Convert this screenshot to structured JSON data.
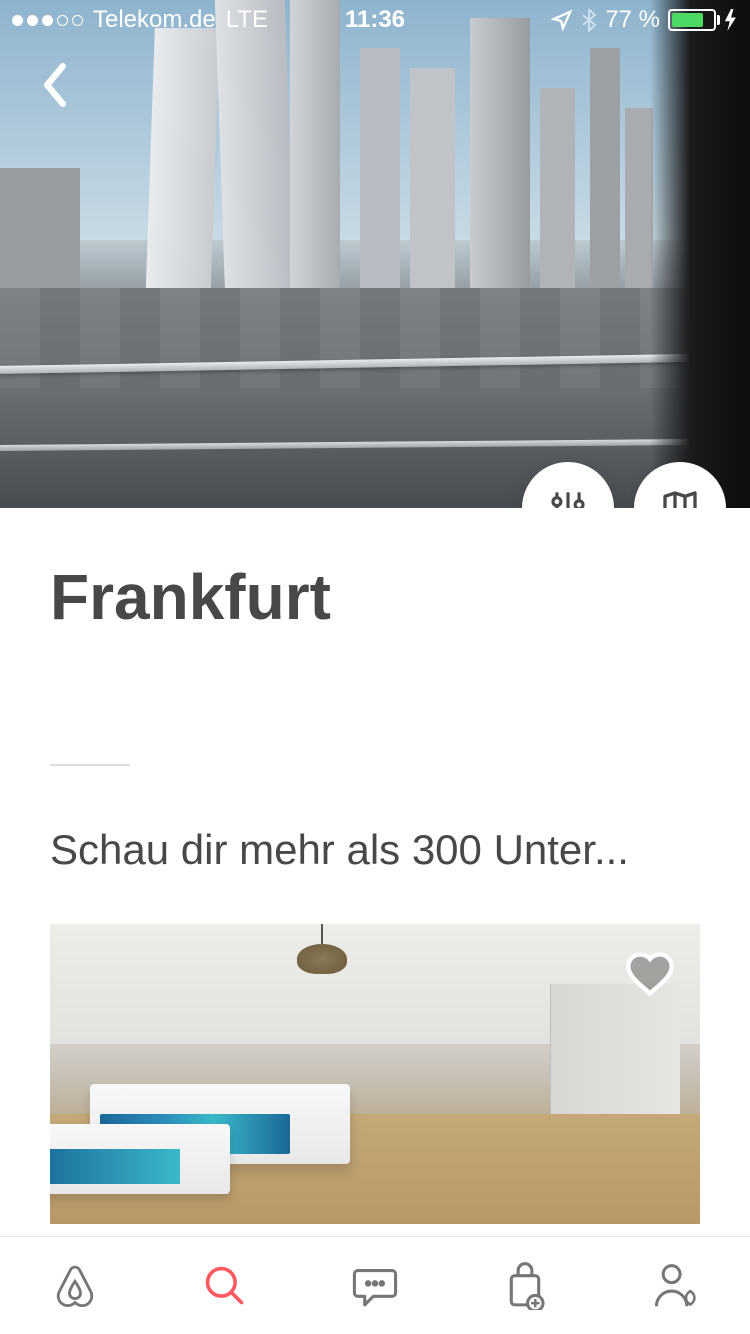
{
  "status_bar": {
    "carrier": "Telekom.de",
    "network": "LTE",
    "time": "11:36",
    "battery_pct": "77 %",
    "signal_strength": 3
  },
  "hero": {
    "back_icon": "chevron-left"
  },
  "actions": {
    "filters_icon": "sliders",
    "map_icon": "map"
  },
  "content": {
    "city_title": "Frankfurt",
    "section_text": "Schau dir mehr als 300 Unter..."
  },
  "listing": {
    "wishlist_icon": "heart"
  },
  "tabbar": {
    "items": [
      {
        "name": "explore",
        "icon": "airbnb-logo",
        "active": false
      },
      {
        "name": "search",
        "icon": "search",
        "active": true
      },
      {
        "name": "inbox",
        "icon": "chat",
        "active": false
      },
      {
        "name": "trips",
        "icon": "bag",
        "active": false
      },
      {
        "name": "profile",
        "icon": "person",
        "active": false
      }
    ]
  },
  "colors": {
    "accent": "#FF5A5F",
    "text_dark": "#484848",
    "icon_gray": "#767676"
  }
}
